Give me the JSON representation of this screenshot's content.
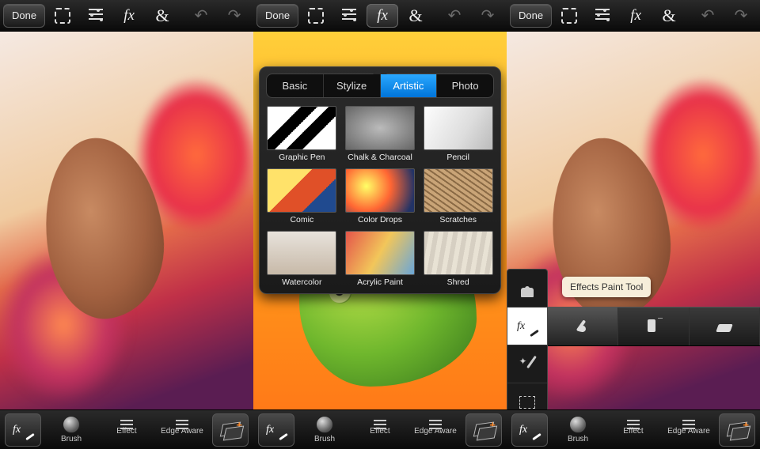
{
  "toolbar": {
    "done": "Done",
    "tools": [
      "crop",
      "adjust",
      "fx",
      "amp",
      "undo",
      "redo"
    ]
  },
  "bottombar": {
    "items": [
      {
        "label": "Brush"
      },
      {
        "label": "Effect"
      },
      {
        "label": "Edge Aware"
      }
    ]
  },
  "fx_panel": {
    "tabs": [
      "Basic",
      "Stylize",
      "Artistic",
      "Photo"
    ],
    "active_tab": "Artistic",
    "effects": [
      "Graphic Pen",
      "Chalk & Charcoal",
      "Pencil",
      "Comic",
      "Color Drops",
      "Scratches",
      "Watercolor",
      "Acrylic Paint",
      "Shred"
    ]
  },
  "tool_palette": {
    "tooltip": "Effects Paint Tool",
    "items": [
      "stamp",
      "fx-brush",
      "wand",
      "marquee"
    ],
    "active": "fx-brush",
    "brush_row": [
      "brush",
      "spray",
      "eraser"
    ],
    "brush_row_active": "brush"
  }
}
